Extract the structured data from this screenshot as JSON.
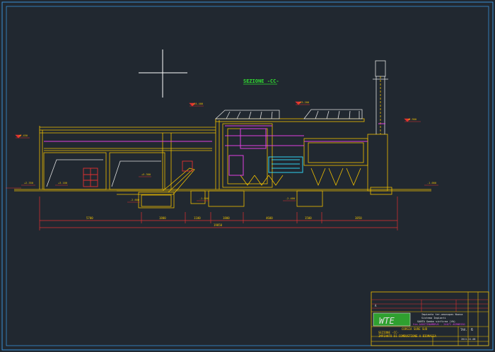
{
  "drawing": {
    "section_title": "SEZIONE -CC-",
    "background_color": "#212830",
    "colors": {
      "frame": "#3a8fd6",
      "structure": "#f0c000",
      "dimension": "#e23030",
      "accent_magenta": "#e040e0",
      "accent_cyan": "#30d0f0",
      "accent_green": "#30e030",
      "crosshair": "#ffffff",
      "outline_white": "#e0e0e0"
    },
    "dimension_values": {
      "segments": [
        "5700",
        "1800",
        "1100",
        "1800",
        "4600",
        "1500",
        "3850"
      ],
      "total": "19850"
    },
    "elevation_labels": [
      "+14.400",
      "+13.200",
      "+8.900",
      "+6.450",
      "+5.300",
      "+3.100",
      "+2.350",
      "-1.000",
      "-1.900",
      "-2.400",
      "-2.600"
    ]
  },
  "title_block": {
    "logo": "WTE",
    "rev_mark": "A",
    "lines": [
      "Impianto ter-omonupas Nuova",
      "Sistema Impianti",
      "SANTA Gamba sinfirea (VA)",
      "Via AGOSTINAMBRUS - 24071 AGRNESSO",
      "CORSIA SURE SUD",
      "SEZIONE -CC-",
      "IMPIANTO DI COMBUSTIONE A BIOMASSA"
    ],
    "sheet_label": "TAV.",
    "sheet_number": "6",
    "date": "2011.11.08"
  }
}
